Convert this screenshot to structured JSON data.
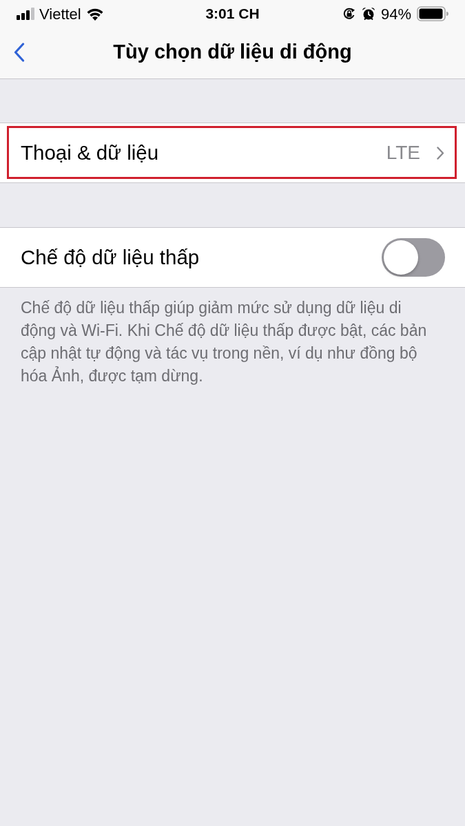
{
  "status_bar": {
    "carrier": "Viettel",
    "time": "3:01 CH",
    "battery": "94%"
  },
  "nav_bar": {
    "title": "Tùy chọn dữ liệu di động"
  },
  "groups": [
    {
      "rows": [
        {
          "kind": "link",
          "label": "Thoại & dữ liệu",
          "value": "LTE",
          "highlighted": true
        }
      ]
    },
    {
      "rows": [
        {
          "kind": "toggle",
          "label": "Chế độ dữ liệu thấp",
          "on": false
        }
      ],
      "footer": "Chế độ dữ liệu thấp giúp giảm mức sử dụng dữ liệu di động và Wi-Fi. Khi Chế độ dữ liệu thấp được bật, các bản cập nhật tự động và tác vụ trong nền, ví dụ như đồng bộ hóa Ảnh, được tạm dừng."
    }
  ]
}
